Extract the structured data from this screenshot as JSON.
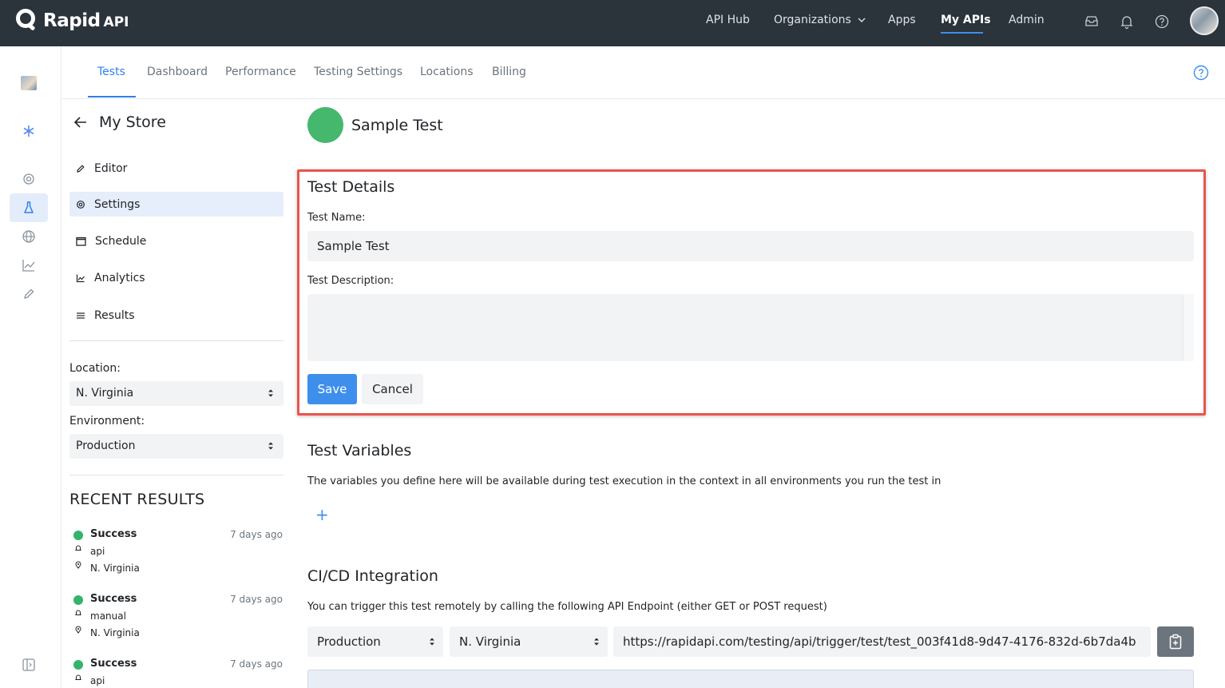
{
  "brand": {
    "name": "Rapid",
    "suffix": "API"
  },
  "topnav": {
    "items": [
      {
        "label": "API Hub"
      },
      {
        "label": "Organizations"
      },
      {
        "label": "Apps"
      },
      {
        "label": "My APIs"
      },
      {
        "label": "Admin"
      }
    ],
    "active": "My APIs"
  },
  "tabs": [
    {
      "label": "Tests"
    },
    {
      "label": "Dashboard"
    },
    {
      "label": "Performance"
    },
    {
      "label": "Testing Settings"
    },
    {
      "label": "Locations"
    },
    {
      "label": "Billing"
    }
  ],
  "sidepanel": {
    "title": "My Store",
    "menu": [
      {
        "label": "Editor",
        "icon": "pencil-icon"
      },
      {
        "label": "Settings",
        "icon": "gear-icon"
      },
      {
        "label": "Schedule",
        "icon": "calendar-icon"
      },
      {
        "label": "Analytics",
        "icon": "chart-icon"
      },
      {
        "label": "Results",
        "icon": "list-icon"
      }
    ],
    "active_menu": "Settings",
    "location_label": "Location:",
    "location_value": "N. Virginia",
    "environment_label": "Environment:",
    "environment_value": "Production",
    "recent_title": "RECENT RESULTS",
    "results": [
      {
        "status": "Success",
        "time": "7 days ago",
        "trigger": "api",
        "location": "N. Virginia"
      },
      {
        "status": "Success",
        "time": "7 days ago",
        "trigger": "manual",
        "location": "N. Virginia"
      },
      {
        "status": "Success",
        "time": "7 days ago",
        "trigger": "api"
      }
    ]
  },
  "main": {
    "test_title": "Sample Test",
    "details": {
      "title": "Test Details",
      "name_label": "Test Name:",
      "name_value": "Sample Test",
      "description_label": "Test Description:",
      "description_value": "",
      "save_label": "Save",
      "cancel_label": "Cancel"
    },
    "variables": {
      "title": "Test Variables",
      "description": "The variables you define here will be available during test execution in the context in all environments you run the test in",
      "add_label": "+"
    },
    "cicd": {
      "title": "CI/CD Integration",
      "description": "You can trigger this test remotely by calling the following API Endpoint (either GET or POST request)",
      "environment": "Production",
      "location": "N. Virginia",
      "url": "https://rapidapi.com/testing/api/trigger/test/test_003f41d8-9d47-4176-832d-6b7da4b"
    }
  },
  "colors": {
    "topbar": "#2b333b",
    "accent": "#3e8fec",
    "success": "#45b86e",
    "highlight": "#e8554e"
  }
}
